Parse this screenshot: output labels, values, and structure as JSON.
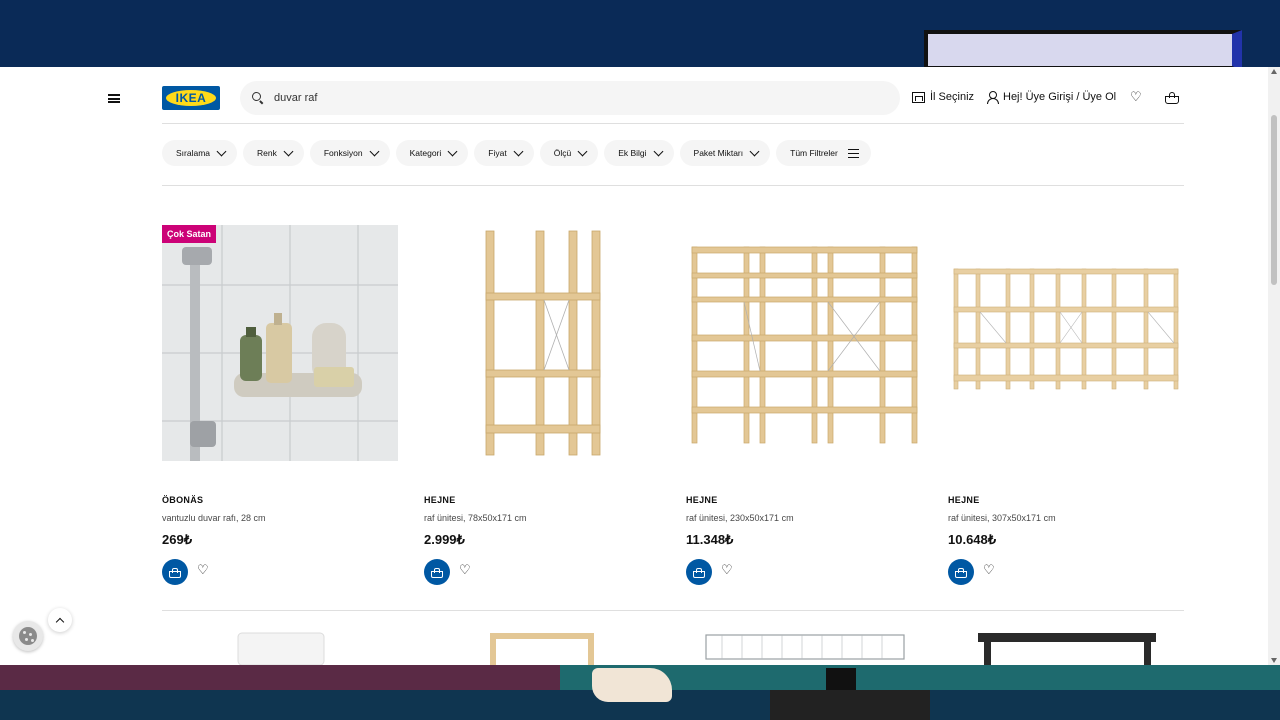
{
  "search": {
    "value": "duvar raf"
  },
  "header": {
    "logo_text": "IKEA",
    "store_label": "İl Seçiniz",
    "account_label": "Hej! Üye Girişi / Üye Ol"
  },
  "filters": [
    {
      "label": "Sıralama"
    },
    {
      "label": "Renk"
    },
    {
      "label": "Fonksiyon"
    },
    {
      "label": "Kategori"
    },
    {
      "label": "Fiyat"
    },
    {
      "label": "Ölçü"
    },
    {
      "label": "Ek Bilgi"
    },
    {
      "label": "Paket Miktarı"
    },
    {
      "label": "Tüm Filtreler"
    }
  ],
  "products": [
    {
      "badge": "Çok Satan",
      "name": "ÖBONÄS",
      "desc": "vantuzlu duvar rafı, 28 cm",
      "price": "269₺"
    },
    {
      "badge": "",
      "name": "HEJNE",
      "desc": "raf ünitesi, 78x50x171 cm",
      "price": "2.999₺"
    },
    {
      "badge": "",
      "name": "HEJNE",
      "desc": "raf ünitesi, 230x50x171 cm",
      "price": "11.348₺"
    },
    {
      "badge": "",
      "name": "HEJNE",
      "desc": "raf ünitesi, 307x50x171 cm",
      "price": "10.648₺"
    }
  ],
  "colors": {
    "ikea_blue": "#0058a3",
    "ikea_yellow": "#ffda1a",
    "badge_magenta": "#cc0277"
  }
}
